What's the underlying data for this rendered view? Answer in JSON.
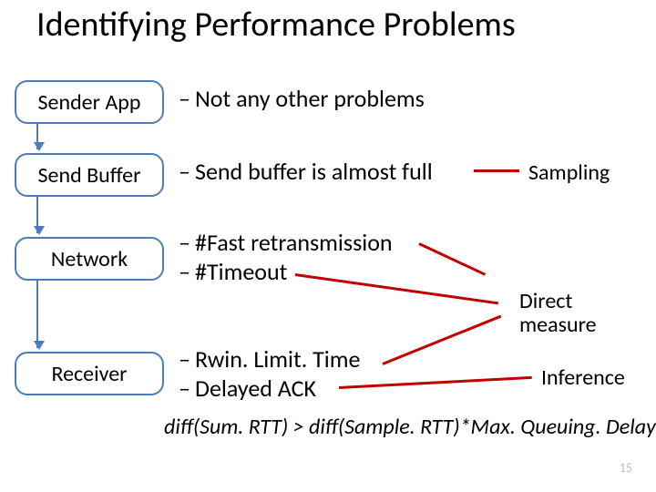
{
  "title": "Identifying Performance Problems",
  "boxes": {
    "sender_app": "Sender App",
    "send_buffer": "Send Buffer",
    "network": "Network",
    "receiver": "Receiver"
  },
  "bullets": {
    "b1": "Not any other problems",
    "b2": "Send buffer is almost full",
    "b3": "#Fast retransmission",
    "b4": "#Timeout",
    "b5": "Rwin. Limit. Time",
    "b6": "Delayed ACK"
  },
  "labels": {
    "sampling": "Sampling",
    "direct1": "Direct",
    "direct2": "measure",
    "inference": "Inference"
  },
  "formula": "diff(Sum. RTT) > diff(Sample. RTT)*Max. Queuing. Delay",
  "page": "15"
}
